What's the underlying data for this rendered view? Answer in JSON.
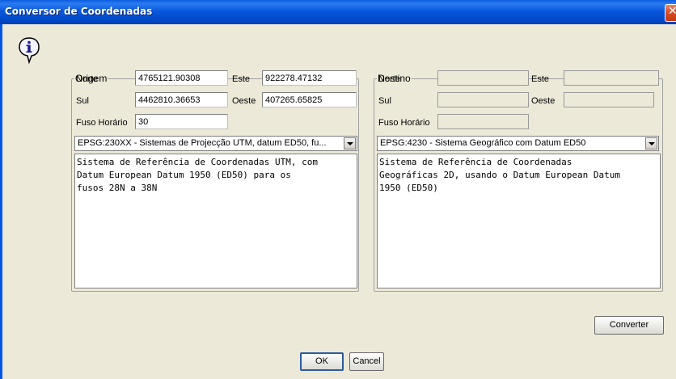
{
  "window": {
    "title": "Conversor de Coordenadas"
  },
  "origem": {
    "legend": "Origem",
    "norte_label": "Norte",
    "norte_value": "4765121.90308",
    "este_label": "Este",
    "este_value": "922278.47132",
    "sul_label": "Sul",
    "sul_value": "4462810.36653",
    "oeste_label": "Oeste",
    "oeste_value": "407265.65825",
    "fuso_label": "Fuso Horário",
    "fuso_value": "30",
    "crs_selected": "EPSG:230XX - Sistemas de Projecção UTM, datum ED50, fu...",
    "description": "Sistema de Referência de Coordenadas UTM, com\nDatum European Datum 1950 (ED50) para os\nfusos 28N a 38N"
  },
  "destino": {
    "legend": "Destino",
    "norte_label": "Norte",
    "norte_value": "",
    "este_label": "Este",
    "este_value": "",
    "sul_label": "Sul",
    "sul_value": "",
    "oeste_label": "Oeste",
    "oeste_value": "",
    "fuso_label": "Fuso Horário",
    "fuso_value": "",
    "crs_selected": "EPSG:4230 - Sistema Geográfico com Datum ED50",
    "description": "Sistema de Referência de Coordenadas\nGeográficas 2D, usando o Datum European Datum\n1950 (ED50)"
  },
  "buttons": {
    "convert": "Converter",
    "ok": "OK",
    "cancel": "Cancel"
  },
  "icons": {
    "info": "info-icon",
    "close": "close-icon"
  },
  "colors": {
    "titlebar": "#0a58dd",
    "close": "#d84a22",
    "dialog_bg": "#ece9d8"
  }
}
